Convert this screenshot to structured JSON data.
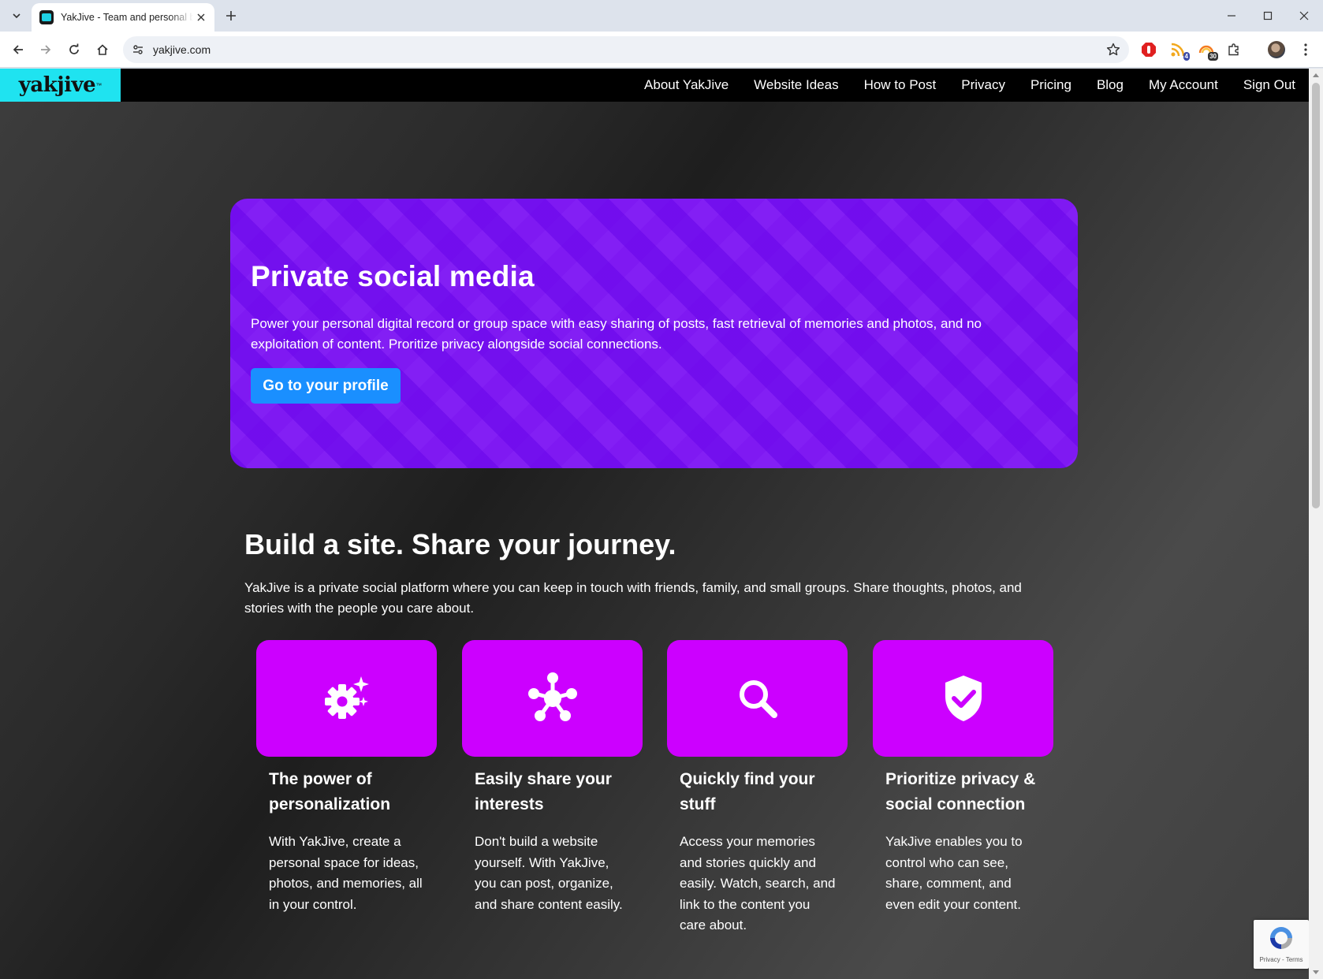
{
  "browser": {
    "tab_title": "YakJive - Team and personal blo",
    "url": "yakjive.com",
    "extensions": [
      {
        "name": "ad-blocker-icon",
        "badge": ""
      },
      {
        "name": "feed-extension-icon",
        "badge": "4"
      },
      {
        "name": "rainbow-extension-icon",
        "badge": "30"
      }
    ]
  },
  "site": {
    "logo": "yakjive",
    "logo_tm": "™",
    "nav": [
      "About YakJive",
      "Website Ideas",
      "How to Post",
      "Privacy",
      "Pricing",
      "Blog",
      "My Account",
      "Sign Out"
    ]
  },
  "hero": {
    "title": "Private social media",
    "text": "Power your personal digital record or group space with easy sharing of posts, fast retrieval of memories and photos, and no exploitation of content. Proritize privacy alongside social connections.",
    "button": "Go to your profile"
  },
  "section": {
    "title": "Build a site. Share your journey.",
    "text": "YakJive is a private social platform where you can keep in touch with friends, family, and small groups. Share thoughts, photos, and stories with the people you care about."
  },
  "features": [
    {
      "icon": "gear-sparkle-icon",
      "title": "The power of personalization",
      "text": "With YakJive, create a personal space for ideas, photos, and memories, all in your control."
    },
    {
      "icon": "network-icon",
      "title": "Easily share your interests",
      "text": "Don't build a website yourself. With YakJive, you can post, organize, and share content easily."
    },
    {
      "icon": "search-icon",
      "title": "Quickly find your stuff",
      "text": "Access your memories and stories quickly and easily. Watch, search, and link to the content you care about."
    },
    {
      "icon": "shield-check-icon",
      "title": "Prioritize privacy & social connection",
      "text": "YakJive enables you to control who can see, share, comment, and even edit your content."
    }
  ],
  "recaptcha": {
    "links": "Privacy - Terms"
  },
  "colors": {
    "logo_bg": "#1fe3f0",
    "hero_bg": "#7310ee",
    "cta": "#1a8fff",
    "feature_tile": "#cc00ff"
  }
}
